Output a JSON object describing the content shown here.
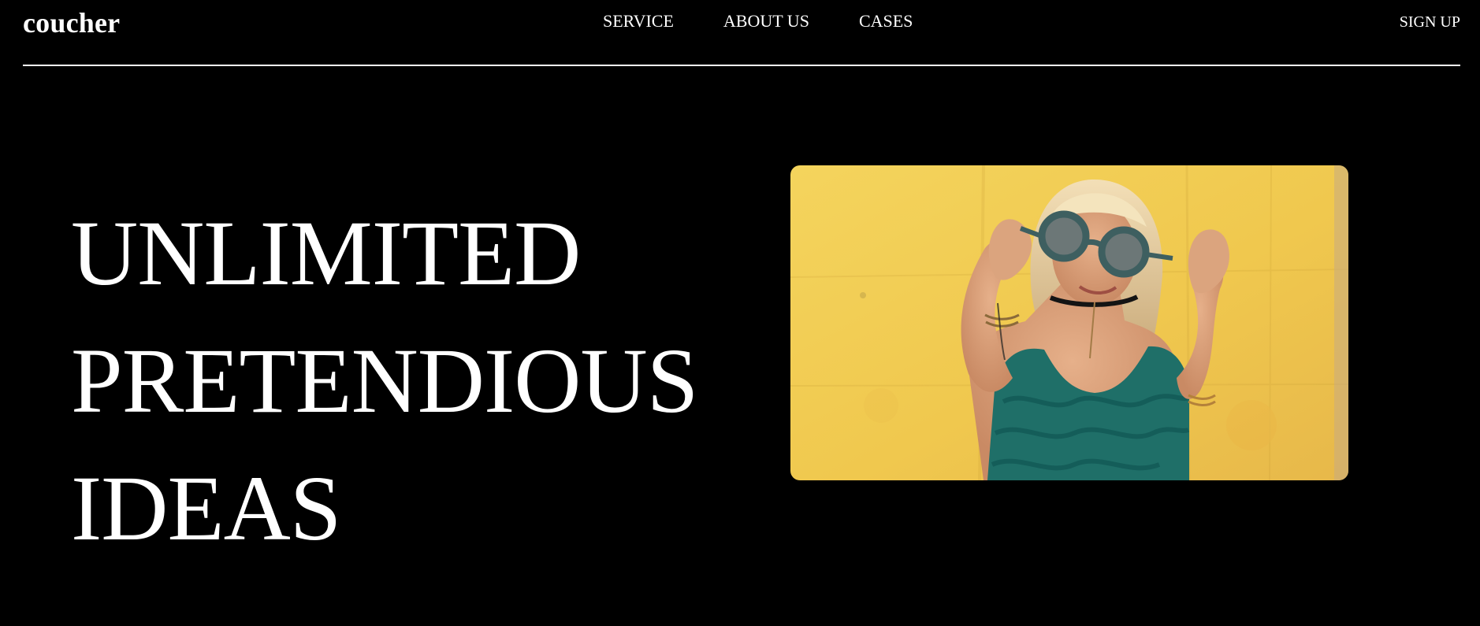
{
  "header": {
    "logo": "coucher",
    "nav": [
      {
        "label": "SERVICE"
      },
      {
        "label": "ABOUT US"
      },
      {
        "label": "CASES"
      }
    ],
    "signup_label": "SIGN UP"
  },
  "hero": {
    "headline_lines": [
      "UNLIMITED",
      "PRETENDIOUS",
      "IDEAS"
    ],
    "image": {
      "subject": "woman-with-round-sunglasses-photo",
      "background_color": "#f2cd53",
      "top_color": "#1f6f68"
    }
  },
  "theme": {
    "background": "#000000",
    "text": "#ffffff"
  }
}
